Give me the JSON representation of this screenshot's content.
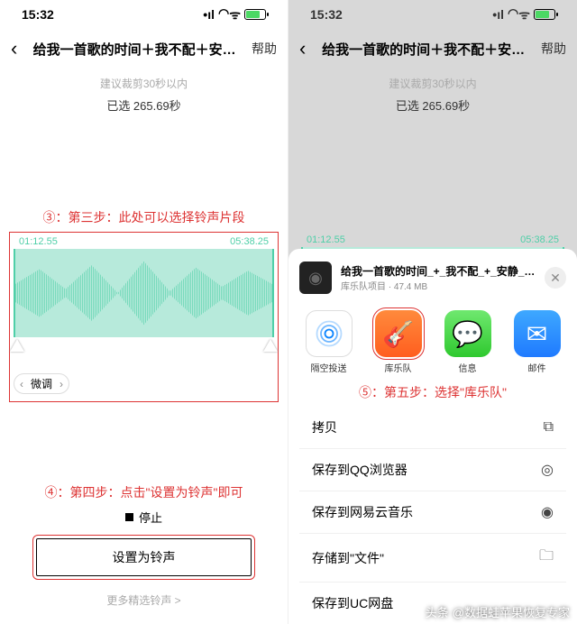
{
  "status": {
    "time": "15:32"
  },
  "nav": {
    "title": "给我一首歌的时间＋我不配＋安…",
    "help": "帮助"
  },
  "trim": {
    "hint": "建议裁剪30秒以内",
    "selected": "已选 265.69秒",
    "start": "01:12.55",
    "end": "05:38.25",
    "fine_tune": "微调"
  },
  "steps": {
    "s3": "③：第三步：此处可以选择铃声片段",
    "s4": "④：第四步：点击\"设置为铃声\"即可",
    "s5": "⑤：第五步：选择\"库乐队\""
  },
  "controls": {
    "stop": "停止",
    "set_ringtone": "设置为铃声",
    "more": "更多精选铃声 >"
  },
  "sheet": {
    "file_title": "给我一首歌的时间_+_我不配_+_安静_+_…",
    "file_sub": "库乐队项目 · 47.4 MB"
  },
  "share": {
    "airdrop": "隔空投送",
    "garageband": "库乐队",
    "messages": "信息",
    "mail": "邮件"
  },
  "actions": {
    "copy": "拷贝",
    "qq": "保存到QQ浏览器",
    "netease": "保存到网易云音乐",
    "files": "存储到\"文件\"",
    "uc": "保存到UC网盘"
  },
  "watermark": {
    "pre": "头条",
    "text": "@数据蛙苹果恢复专家"
  }
}
